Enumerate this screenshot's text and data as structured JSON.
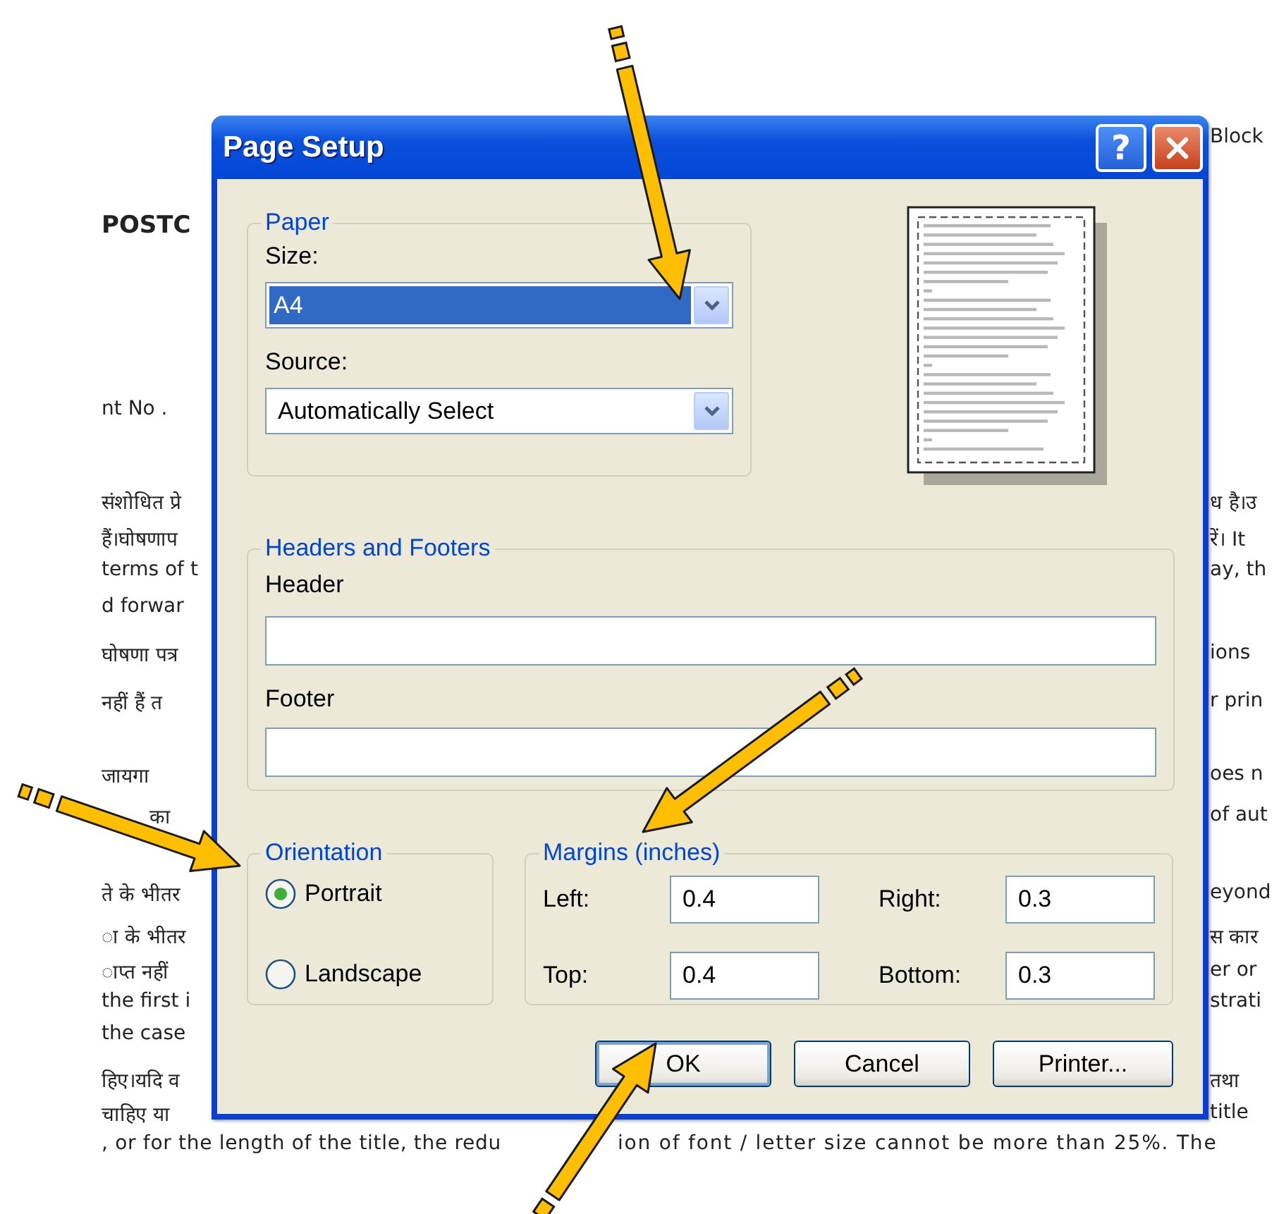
{
  "document": {
    "lines": [
      {
        "kind": "line",
        "right": "Block"
      },
      {
        "kind": "heading",
        "left": "POSTC"
      },
      {
        "kind": "line",
        "left": "nt No ."
      },
      {
        "kind": "line",
        "left": "संशोधित प्रे",
        "right": "ध है।उ"
      },
      {
        "kind": "line",
        "left": "हैं।घोषणाप",
        "right": "रें। It"
      },
      {
        "kind": "line",
        "left": "terms of t",
        "right": "ay, th"
      },
      {
        "kind": "line",
        "left": "d forwar"
      },
      {
        "kind": "line",
        "left": "घोषणा पत्र",
        "right": "ions"
      },
      {
        "kind": "line",
        "left": "नहीं हैं त",
        "right": "r prin"
      },
      {
        "kind": "line",
        "left": "जायगा",
        "right": "oes n"
      },
      {
        "kind": "line",
        "left": "का",
        "right": "of aut"
      },
      {
        "kind": "line",
        "left": "ते के भीतर",
        "right": "eyond"
      },
      {
        "kind": "line",
        "left": "ा के भीतर",
        "right": "स कार"
      },
      {
        "kind": "line",
        "left": "ाप्त नहीं",
        "right": "er or"
      },
      {
        "kind": "line",
        "left": "the first i",
        "right": "strati"
      },
      {
        "kind": "line",
        "left": "the case"
      },
      {
        "kind": "line",
        "left": "हिए।यदि व",
        "right": "तथा"
      },
      {
        "kind": "line",
        "left": "चाहिए या",
        "right": "title"
      },
      {
        "kind": "full",
        "left": ", or for the length of the title, the redu",
        "right": "ion of font / letter size cannot be more than 25%. The"
      }
    ]
  },
  "dialog": {
    "title": "Page Setup",
    "help_button": "?",
    "paper": {
      "title": "Paper",
      "size": {
        "label": "Size:",
        "value": "A4",
        "highlighted": true
      },
      "source": {
        "label": "Source:",
        "value": "Automatically Select",
        "highlighted": false
      }
    },
    "headers_and_footers": {
      "title": "Headers and Footers",
      "header": {
        "label": "Header"
      },
      "footer": {
        "label": "Footer"
      }
    },
    "orientation": {
      "title": "Orientation",
      "options": [
        {
          "label": "Portrait",
          "selected": true
        },
        {
          "label": "Landscape",
          "selected": false
        }
      ]
    },
    "margins": {
      "title": "Margins (inches)",
      "fields": [
        {
          "label": "Left:",
          "value": "0.4"
        },
        {
          "label": "Right:",
          "value": "0.3"
        },
        {
          "label": "Top:",
          "value": "0.4"
        },
        {
          "label": "Bottom:",
          "value": "0.3"
        }
      ]
    },
    "buttons": [
      {
        "label": "OK",
        "default": true
      },
      {
        "label": "Cancel",
        "default": false
      },
      {
        "label": "Printer...",
        "default": false
      }
    ]
  },
  "annotations": [
    {
      "kind": "arrow"
    },
    {
      "kind": "arrow"
    },
    {
      "kind": "arrow"
    },
    {
      "kind": "arrow"
    }
  ]
}
